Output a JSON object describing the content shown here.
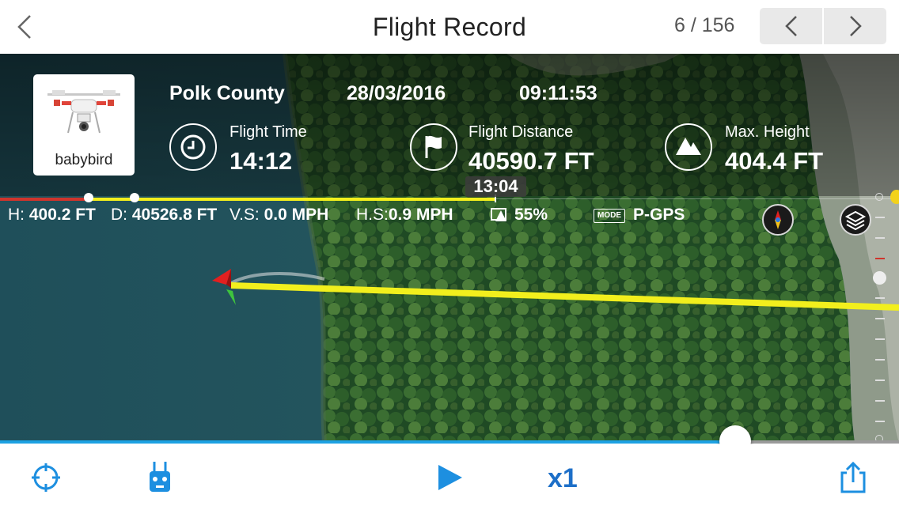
{
  "header": {
    "title": "Flight Record",
    "counter": "6 / 156"
  },
  "flight": {
    "aircraft_name": "babybird",
    "location": "Polk County",
    "date": "28/03/2016",
    "time": "09:11:53"
  },
  "stats": [
    {
      "label": "Flight Time",
      "value": "14:12",
      "icon": "clock-icon"
    },
    {
      "label": "Flight Distance",
      "value": "40590.7 FT",
      "icon": "flag-icon"
    },
    {
      "label": "Max. Height",
      "value": "404.4 FT",
      "icon": "mountain-icon"
    }
  ],
  "playback": {
    "timestamp": "13:04",
    "speed": "x1",
    "progress": 0.818
  },
  "telemetry": {
    "h_label": "H:",
    "h_value": "400.2 FT",
    "d_label": "D:",
    "d_value": "40526.8 FT",
    "vs_label": "V.S:",
    "vs_value": "0.0 MPH",
    "hs_label": "H.S:",
    "hs_value": "0.9 MPH",
    "battery_value": "55%",
    "mode_badge": "MODE",
    "mode_value": "P-GPS"
  },
  "colors": {
    "accent": "#1da1e2",
    "flight_path": "#f2ef1d",
    "timeline_red": "#d0342c",
    "speed_text": "#1d6fc8"
  }
}
